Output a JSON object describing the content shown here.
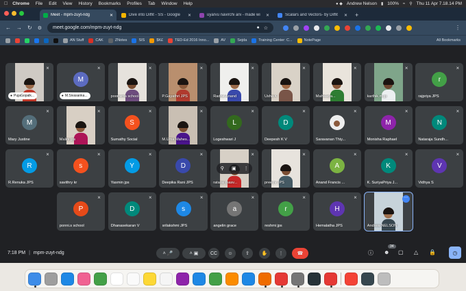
{
  "menubar": {
    "app": "Chrome",
    "items": [
      "File",
      "Edit",
      "View",
      "History",
      "Bookmarks",
      "Profiles",
      "Tab",
      "Window",
      "Help"
    ],
    "user": "Andrew Nelson",
    "battery": "100%",
    "datetime": "Thu 11 Apr  7.18.14 PM"
  },
  "tabs": [
    {
      "label": "Meet - mpm-zuyt-ndg",
      "color": "#00ac47",
      "active": true
    },
    {
      "label": "Dive into Diffit - SS - Google",
      "color": "#f4b400",
      "active": false
    },
    {
      "label": "uyarvu navirchi ani - made wi",
      "color": "#8e44ad",
      "active": false
    },
    {
      "label": "Scalars and Vectors- by Diffit",
      "color": "#4285f4",
      "active": false
    }
  ],
  "address": {
    "url": "meet.google.com/mpm-zuyt-ndg"
  },
  "bookmarks": {
    "items": [
      {
        "label": "AN Stuff",
        "color": "#9aa0a6"
      },
      {
        "label": "CAK",
        "color": "#d93025"
      },
      {
        "label": "ZNotes",
        "color": "#5f6368"
      },
      {
        "label": "SIS",
        "color": "#1a73e8"
      },
      {
        "label": "$K£",
        "color": "#f29900"
      },
      {
        "label": "TED-Ed 2016 Inno...",
        "color": "#ea4335"
      },
      {
        "label": "AV",
        "color": "#9aa0a6"
      },
      {
        "label": "Sejda",
        "color": "#34a853"
      },
      {
        "label": "Training Center: C...",
        "color": "#1a73e8"
      },
      {
        "label": "NotePage",
        "color": "#fbbc04"
      }
    ],
    "all": "All Bookmarks"
  },
  "participants": [
    {
      "name": "PujaGopalk...",
      "type": "video",
      "pinned": true,
      "bg": "#cfcac4",
      "skin": "#9c6b4a",
      "shirt": "#c0392b"
    },
    {
      "name": "M.Sivasanka...",
      "type": "avatar",
      "initial": "M",
      "color": "#5c6bc0",
      "pinned": true
    },
    {
      "name": "poornima school",
      "type": "video",
      "bg": "#e6e2dc",
      "skin": "#7b4e33",
      "shirt": "#6d4c7d"
    },
    {
      "name": "P.Gayathri JPS",
      "type": "video",
      "bg": "#b98f6e",
      "skin": "#8b5a3c",
      "shirt": "#b03a2e"
    },
    {
      "name": "Radha Anand",
      "type": "video",
      "bg": "#efefed",
      "skin": "#9c6b4a",
      "shirt": "#3949ab"
    },
    {
      "name": "Usha K",
      "type": "video",
      "bg": "#d9d2c7",
      "skin": "#a06a46",
      "shirt": "#795548"
    },
    {
      "name": "Mahalaya...",
      "type": "video",
      "bg": "#e9e4dc",
      "skin": "#8b5a3c",
      "shirt": "#2e7d32"
    },
    {
      "name": "karthik.m.jp",
      "type": "video",
      "bg": "#7fa58a",
      "skin": "#6d4530",
      "shirt": "#eceff1"
    },
    {
      "name": "rajpriya JPS",
      "type": "avatar",
      "initial": "r",
      "color": "#43a047"
    },
    {
      "name": "Mary Justine",
      "type": "avatar",
      "initial": "M",
      "color": "#546e7a"
    },
    {
      "name": "Malini jps",
      "type": "video",
      "bg": "#d8cfc4",
      "skin": "#8b5a3c",
      "shirt": "#ad1457"
    },
    {
      "name": "Sumathy Social",
      "type": "avatar",
      "initial": "S",
      "color": "#f4511e"
    },
    {
      "name": "M.Uma Mahes...",
      "type": "video",
      "bg": "#c9bfb3",
      "skin": "#7b4e33",
      "shirt": "#4a148c"
    },
    {
      "name": "Logeshwari J",
      "type": "avatar",
      "initial": "L",
      "color": "#33691e"
    },
    {
      "name": "Deepesh K V",
      "type": "avatar",
      "initial": "D",
      "color": "#00897b"
    },
    {
      "name": "Saravanan Thiy...",
      "type": "photo",
      "color": "#eeeeee"
    },
    {
      "name": "Monisha Raphael",
      "type": "avatar",
      "initial": "M",
      "color": "#8e24aa"
    },
    {
      "name": "Nataraja Sundh...",
      "type": "avatar",
      "initial": "N",
      "color": "#00897b"
    },
    {
      "name": "R.Renuka JPS",
      "type": "avatar",
      "initial": "R",
      "color": "#039be5"
    },
    {
      "name": "savithry kr",
      "type": "avatar",
      "initial": "s",
      "color": "#f4511e"
    },
    {
      "name": "Yasmin jps",
      "type": "avatar",
      "initial": "Y",
      "color": "#039be5"
    },
    {
      "name": "Deepika Rani JPS",
      "type": "avatar",
      "initial": "D",
      "color": "#3949ab"
    },
    {
      "name": "ratana thasv...",
      "type": "video",
      "bg": "#d7d0c6",
      "skin": "#7b4e33",
      "shirt": "#c62828",
      "hover": true
    },
    {
      "name": "preethi JPS",
      "type": "video",
      "bg": "#e7e3dd",
      "skin": "#7b4e33",
      "shirt": "#455a64"
    },
    {
      "name": "Anand Francis ...",
      "type": "avatar",
      "initial": "A",
      "color": "#7cb342"
    },
    {
      "name": "K. SuriyaPriya J...",
      "type": "avatar",
      "initial": "K",
      "color": "#00897b"
    },
    {
      "name": "Vidhya S",
      "type": "avatar",
      "initial": "V",
      "color": "#5e35b1"
    },
    {
      "name": "ponni.s school",
      "type": "avatar",
      "initial": "P",
      "color": "#e64a19"
    },
    {
      "name": "Dhanasekaran V",
      "type": "avatar",
      "initial": "D",
      "color": "#00897b"
    },
    {
      "name": "srilakshmi JPS",
      "type": "avatar",
      "initial": "s",
      "color": "#1e88e5"
    },
    {
      "name": "angelin grace",
      "type": "avatar",
      "initial": "a",
      "color": "#757575"
    },
    {
      "name": "reshmi jps",
      "type": "avatar",
      "initial": "r",
      "color": "#43a047"
    },
    {
      "name": "Hemalatha JPS",
      "type": "avatar",
      "initial": "H",
      "color": "#5e35b1"
    },
    {
      "name": "Andrew NELSON",
      "type": "video",
      "bg": "#c7d3da",
      "skin": "#a0714f",
      "shirt": "#37474f",
      "self": true
    }
  ],
  "controls": {
    "time": "7:18 PM",
    "meeting_code": "mpm-zuyt-ndg",
    "people_count": "34"
  },
  "dock": [
    {
      "name": "finder",
      "color": "#3d8ce8"
    },
    {
      "name": "launchpad",
      "color": "#9e9e9e"
    },
    {
      "name": "safari",
      "color": "#1e88e5"
    },
    {
      "name": "photos",
      "color": "#f06292"
    },
    {
      "name": "facetime",
      "color": "#43a047"
    },
    {
      "name": "calendar",
      "color": "#ffffff"
    },
    {
      "name": "reminders",
      "color": "#fafafa"
    },
    {
      "name": "notes",
      "color": "#fdd835"
    },
    {
      "name": "freeform",
      "color": "#f5f5f5"
    },
    {
      "name": "podcasts",
      "color": "#8e24aa"
    },
    {
      "name": "keynote",
      "color": "#1e88e5"
    },
    {
      "name": "numbers",
      "color": "#43a047"
    },
    {
      "name": "pages",
      "color": "#fb8c00"
    },
    {
      "name": "app-store",
      "color": "#1e88e5"
    },
    {
      "name": "sublime",
      "color": "#ef6c00"
    },
    {
      "name": "acrobat",
      "color": "#e53935"
    },
    {
      "name": "system-settings",
      "color": "#757575"
    },
    {
      "name": "steam",
      "color": "#263238"
    },
    {
      "name": "chrome",
      "color": "#e53935"
    },
    {
      "name": "music",
      "color": "#f44336"
    },
    {
      "name": "screen",
      "color": "#37474f"
    },
    {
      "name": "trash",
      "color": "#bdbdbd"
    }
  ]
}
